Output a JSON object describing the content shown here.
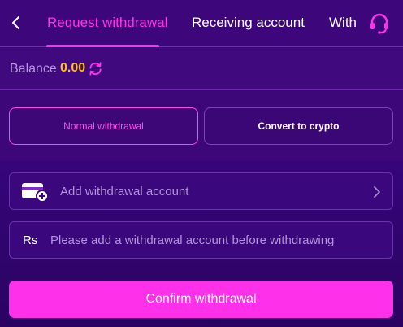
{
  "header": {
    "tabs": [
      {
        "label": "Request withdrawal",
        "active": true
      },
      {
        "label": "Receiving account",
        "active": false
      },
      {
        "label": "With",
        "active": false
      }
    ],
    "back_icon": "chevron-left-icon",
    "support_icon": "headset-icon"
  },
  "balance": {
    "label": "Balance",
    "value": "0.00",
    "refresh_icon": "refresh-icon"
  },
  "modes": {
    "normal_label": "Normal withdrawal",
    "crypto_label": "Convert to crypto",
    "selected": "normal"
  },
  "form": {
    "account_label": "Add withdrawal account",
    "currency_symbol": "Rs",
    "amount_placeholder": "Please add a withdrawal account before withdrawing",
    "amount_value": ""
  },
  "confirm_label": "Confirm withdrawal",
  "colors": {
    "accent": "#ff30e9",
    "background": "#3c0476",
    "balance": "#ffbe1a"
  }
}
